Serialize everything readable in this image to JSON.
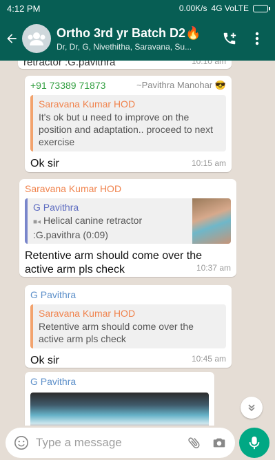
{
  "status": {
    "time": "4:12 PM",
    "network": "0.00K/s",
    "signal": "4G VoLTE"
  },
  "header": {
    "title": "Ortho 3rd yr Batch D2",
    "title_emoji": "🔥",
    "subtitle": "Dr, Dr, G, Nivethitha, Saravana, Su..."
  },
  "messages": [
    {
      "partial_text": "retractor :G.pavithra",
      "partial_time": "10:10 am"
    },
    {
      "phone": "+91 73389 71873",
      "sender_alias": "~Pavithra Manohar 😎",
      "quote_name": "Saravana Kumar HOD",
      "quote_text": "It's ok but u need to improve on the position and adaptation.. proceed to next exercise",
      "text": "Ok sir",
      "time": "10:15 am"
    },
    {
      "sender": "Saravana Kumar HOD",
      "quote_name": "G Pavithra",
      "quote_text": "Helical canine retractor :G.pavithra (0:09)",
      "text": "Retentive arm should come over the active arm pls check",
      "time": "10:37 am"
    },
    {
      "sender": "G Pavithra",
      "quote_name": "Saravana Kumar HOD",
      "quote_text": "Retentive arm should come over the active arm pls check",
      "text": "Ok sir",
      "time": "10:45 am"
    },
    {
      "sender": "G Pavithra"
    }
  ],
  "composer": {
    "placeholder": "Type a message"
  }
}
